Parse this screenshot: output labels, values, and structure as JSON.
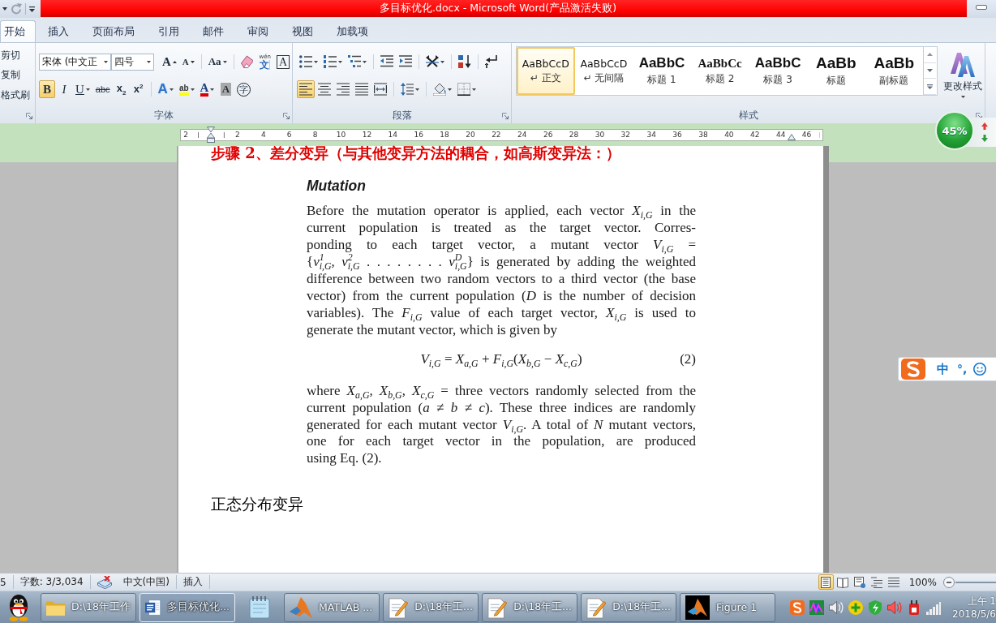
{
  "title_bar": {
    "title": "多目标优化.docx - Microsoft Word(产品激活失败)"
  },
  "ribbon_tabs": [
    {
      "label": "开始",
      "selected": true
    },
    {
      "label": "插入",
      "selected": false
    },
    {
      "label": "页面布局",
      "selected": false
    },
    {
      "label": "引用",
      "selected": false
    },
    {
      "label": "邮件",
      "selected": false
    },
    {
      "label": "审阅",
      "selected": false
    },
    {
      "label": "视图",
      "selected": false
    },
    {
      "label": "加载项",
      "selected": false
    }
  ],
  "clipboard_group": {
    "commands": [
      "剪切",
      "复制",
      "格式刷"
    ]
  },
  "font_group": {
    "label": "字体",
    "font_name": "宋体 (中文正",
    "font_size": "四号",
    "row_1": [
      {
        "kind": "grow_font",
        "glyph": "A"
      },
      {
        "kind": "shrink_font",
        "glyph": "A"
      },
      {
        "kind": "change_case",
        "glyph": "Aa"
      },
      {
        "kind": "clear_format"
      },
      {
        "kind": "phonetic_guide",
        "glyph": "文",
        "ruby": "wén"
      },
      {
        "kind": "char_border",
        "glyph": "A"
      }
    ],
    "row_2": [
      {
        "kind": "bold",
        "glyph": "B",
        "on": true
      },
      {
        "kind": "italic",
        "glyph": "I",
        "on": false
      },
      {
        "kind": "underline",
        "glyph": "U",
        "on": false
      },
      {
        "kind": "strikethrough",
        "glyph": "abc",
        "on": false
      },
      {
        "kind": "subscript",
        "glyph": "x",
        "index": "2",
        "on": false
      },
      {
        "kind": "superscript",
        "glyph": "x",
        "index": "2",
        "on": false
      },
      {
        "kind": "text_effect",
        "glyph": "A",
        "on": false
      },
      {
        "kind": "highlight",
        "glyph": "ab",
        "on": false
      },
      {
        "kind": "font_color",
        "glyph": "A",
        "on": false
      },
      {
        "kind": "char_shading",
        "glyph": "A",
        "on": false
      },
      {
        "kind": "enclose",
        "glyph": "字",
        "on": false
      }
    ]
  },
  "paragraph_group": {
    "label": "段落",
    "row_1": [
      {
        "kind": "bullets"
      },
      {
        "kind": "numbering"
      },
      {
        "kind": "multilevel_list"
      },
      {
        "kind": "decrease_indent"
      },
      {
        "kind": "increase_indent"
      },
      {
        "kind": "chinese_layout"
      },
      {
        "kind": "sort"
      },
      {
        "kind": "show_marks"
      }
    ],
    "row_2": [
      {
        "kind": "align_left",
        "on": true
      },
      {
        "kind": "align_center",
        "on": false
      },
      {
        "kind": "align_right",
        "on": false
      },
      {
        "kind": "justify",
        "on": false
      },
      {
        "kind": "distribute",
        "on": false
      },
      {
        "kind": "line_spacing",
        "on": false
      },
      {
        "kind": "shading",
        "on": false
      },
      {
        "kind": "borders",
        "on": false
      }
    ]
  },
  "styles_group": {
    "label": "样式",
    "gallery": [
      {
        "kind": "normal",
        "sample": "AaBbCcD",
        "name": "↵ 正文",
        "selected": true
      },
      {
        "kind": "no_spacing",
        "sample": "AaBbCcD",
        "name": "↵ 无间隔",
        "selected": false
      },
      {
        "kind": "heading_1",
        "sample": "AaBbC",
        "name": "标题 1",
        "selected": false
      },
      {
        "kind": "heading_2",
        "sample": "AaBbCc",
        "name": "标题 2",
        "selected": false
      },
      {
        "kind": "heading_3",
        "sample": "AaBbC",
        "name": "标题 3",
        "selected": false
      },
      {
        "kind": "title",
        "sample": "AaBb",
        "name": "标题",
        "selected": false
      },
      {
        "kind": "subtitle",
        "sample": "AaBb",
        "name": "副标题",
        "selected": false
      }
    ],
    "change_styles": "更改样式"
  },
  "ruler": {
    "labels": [
      "2",
      "2",
      "4",
      "6",
      "8",
      "10",
      "12",
      "14",
      "16",
      "18",
      "20",
      "22",
      "24",
      "26",
      "28",
      "30",
      "32",
      "34",
      "36",
      "38",
      "40",
      "42",
      "44",
      "46"
    ]
  },
  "performance_ball": {
    "reading": "45%"
  },
  "document": {
    "heading": "步骤 2、差分变异（与其他变异方法的耦合，如高斯变异法：）",
    "excerpt": {
      "title": "Mutation",
      "paragraph_1": [
        "Before the mutation operator is applied, each vector *X*$_{i,G}$ in the",
        "current population is treated as the target vector. Corres-",
        "ponding to each target vector, a mutant vector *V*$_{i,G}$ =",
        "{*v*$^{1}$$_{i,G}$, *v*$^{2}$$_{i,G}$ . . . . . . . . *v*$^{D}$$_{i,G}$} is generated by adding the weighted",
        "difference between two random vectors to a third vector (the base",
        "vector) from the current population (*D* is the number of decision",
        "variables). The *F*$_{i,G}$ value of each target vector, *X*$_{i,G}$ is used to",
        "generate the mutant vector, which is given by"
      ],
      "equation": "*V*$_{i,G}$ = *X*$_{a,G}$ + *F*$_{i,G}$(*X*$_{b,G}$ − *X*$_{c,G}$)",
      "equation_number": "(2)",
      "paragraph_2": [
        "where *X*$_{a,G}$, *X*$_{b,G}$, *X*$_{c,G}$ = three vectors randomly selected from the",
        "current population (*a* ≠ *b* ≠ *c*). These three indices are randomly",
        "generated for each mutant vector *V*$_{i,G}$. A total of *N* mutant vectors,",
        "one for each target vector in the population, are produced",
        "using Eq. (2)."
      ]
    },
    "subheading": "正态分布变异"
  },
  "ime_bar": {
    "mode": "中",
    "punctuation": "°,"
  },
  "status_bar": {
    "page": "5",
    "word_count": "字数: 3/3,034",
    "language": "中文(中国)",
    "mode": "插入",
    "views": [
      {
        "kind": "print_layout",
        "selected": true
      },
      {
        "kind": "reading",
        "selected": false
      },
      {
        "kind": "web_layout",
        "selected": false
      },
      {
        "kind": "outline",
        "selected": false
      },
      {
        "kind": "draft",
        "selected": false
      }
    ],
    "zoom": "100%"
  },
  "taskbar": {
    "buttons": [
      {
        "kind": "folder",
        "label": "D:\\18年工作",
        "selected": false
      },
      {
        "kind": "word",
        "label": "多目标优化...",
        "selected": true
      },
      {
        "kind": "notepad",
        "selected": false
      },
      {
        "kind": "matlab",
        "label": "MATLAB ...",
        "selected": false
      },
      {
        "kind": "editor",
        "label": "D:\\18年工...",
        "selected": false
      },
      {
        "kind": "editor",
        "label": "D:\\18年工...",
        "selected": false
      },
      {
        "kind": "editor",
        "label": "D:\\18年工...",
        "selected": false
      },
      {
        "kind": "figure",
        "label": "Figure 1",
        "selected": false
      }
    ],
    "clock": {
      "time": "上午 1",
      "date": "2018/5/6"
    }
  }
}
